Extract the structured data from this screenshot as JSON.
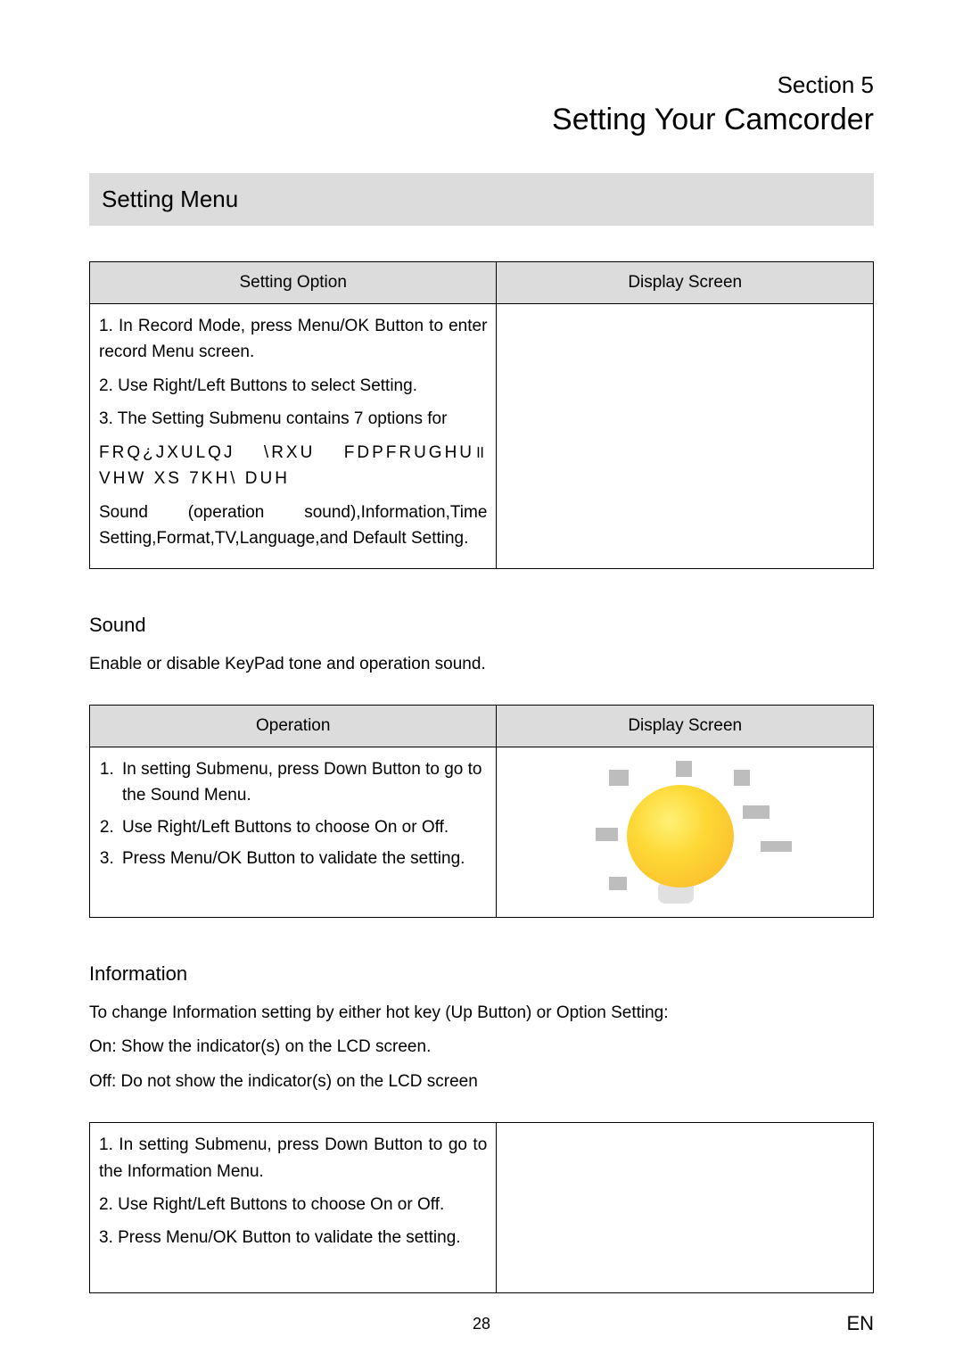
{
  "section": {
    "label": "Section 5",
    "title": "Setting Your Camcorder"
  },
  "setting_menu": {
    "heading": "Setting Menu",
    "table": {
      "col1": "Setting Option",
      "col2": "Display Screen",
      "step1": "1. In Record Mode, press Menu/OK Button to enter record Menu screen.",
      "step2": "2. Use Right/Left Buttons to select Setting.",
      "step3a": "3. The Setting Submenu contains 7 options for",
      "step3b": "FRQ¿JXULQJ \\RXU FDPFRUGHU॥ VHW XS  7KH\\ DUH",
      "step3c": "Sound (operation sound),Information,Time Setting,Format,TV,Language,and Default Setting."
    }
  },
  "sound": {
    "heading": "Sound",
    "desc": "Enable or disable KeyPad tone and operation sound.",
    "table": {
      "col1": "Operation",
      "col2": "Display Screen",
      "step1": "In setting Submenu, press Down Button to go to the Sound Menu.",
      "step2": "Use Right/Left Buttons to choose On or Off.",
      "step3": "Press Menu/OK Button to validate the setting."
    }
  },
  "information": {
    "heading": "Information",
    "desc1": "To change Information setting by either hot key (Up Button) or Option Setting:",
    "desc2": "On: Show the indicator(s) on the LCD screen.",
    "desc3": "Off: Do not show the indicator(s) on the LCD screen",
    "table": {
      "step1": "1. In setting Submenu, press Down Button to go to the Information Menu.",
      "step2": "2. Use Right/Left Buttons to choose On or Off.",
      "step3": "3. Press Menu/OK Button to validate the setting."
    }
  },
  "footer": {
    "page": "28",
    "lang": "EN"
  }
}
